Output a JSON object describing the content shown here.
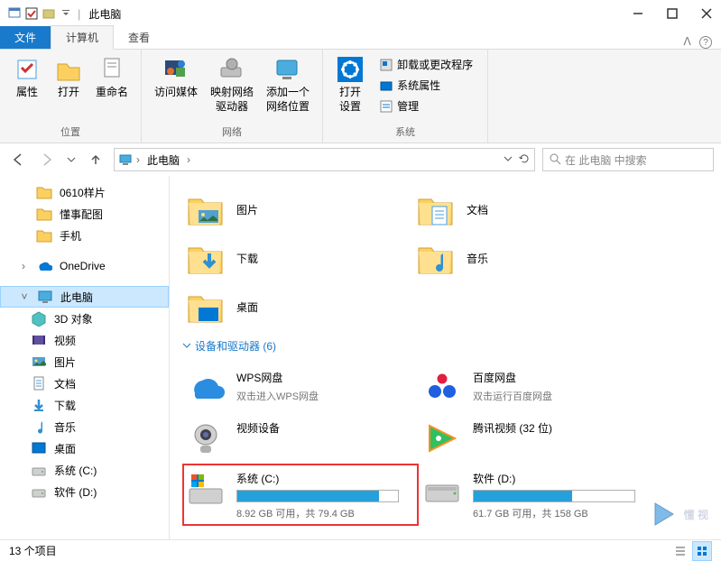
{
  "window": {
    "title": "此电脑"
  },
  "tabs": {
    "file": "文件",
    "computer": "计算机",
    "view": "查看"
  },
  "ribbon": {
    "g_loc": {
      "props": "属性",
      "open": "打开",
      "rename": "重命名",
      "label": "位置"
    },
    "g_net": {
      "media": "访问媒体",
      "net_drive": "映射网络\n驱动器",
      "add_loc": "添加一个\n网络位置",
      "label": "网络"
    },
    "g_sys": {
      "open_settings": "打开\n设置",
      "uninstall": "卸载或更改程序",
      "props": "系统属性",
      "manage": "管理",
      "label": "系统"
    }
  },
  "breadcrumbs": {
    "root": "此电脑"
  },
  "search": {
    "placeholder": "在 此电脑 中搜索"
  },
  "sidebar": {
    "items": [
      {
        "label": "0610样片",
        "type": "folder"
      },
      {
        "label": "懂事配图",
        "type": "folder"
      },
      {
        "label": "手机",
        "type": "folder"
      },
      {
        "label": "OneDrive",
        "type": "onedrive"
      },
      {
        "label": "此电脑",
        "type": "pc",
        "sel": true
      },
      {
        "label": "3D 对象",
        "type": "3d",
        "indent": true
      },
      {
        "label": "视频",
        "type": "video",
        "indent": true
      },
      {
        "label": "图片",
        "type": "pic",
        "indent": true
      },
      {
        "label": "文档",
        "type": "doc",
        "indent": true
      },
      {
        "label": "下载",
        "type": "dl",
        "indent": true
      },
      {
        "label": "音乐",
        "type": "music",
        "indent": true
      },
      {
        "label": "桌面",
        "type": "desk",
        "indent": true
      },
      {
        "label": "系统 (C:)",
        "type": "drive",
        "indent": true
      },
      {
        "label": "软件 (D:)",
        "type": "drive",
        "indent": true
      }
    ]
  },
  "content": {
    "folders": [
      {
        "label": "图片",
        "type": "pic"
      },
      {
        "label": "文档",
        "type": "doc"
      },
      {
        "label": "下载",
        "type": "dl"
      },
      {
        "label": "音乐",
        "type": "music"
      },
      {
        "label": "桌面",
        "type": "desk"
      }
    ],
    "section_head": "设备和驱动器 (6)",
    "drives": [
      {
        "name": "WPS网盘",
        "sub": "双击进入WPS网盘",
        "type": "wps"
      },
      {
        "name": "百度网盘",
        "sub": "双击运行百度网盘",
        "type": "baidu"
      },
      {
        "name": "视频设备",
        "sub": "",
        "type": "cam"
      },
      {
        "name": "腾讯视频 (32 位)",
        "sub": "",
        "type": "tencent"
      },
      {
        "name": "系统 (C:)",
        "info": "8.92 GB 可用，共 79.4 GB",
        "type": "sysdrive",
        "fill": 88,
        "boxed": true
      },
      {
        "name": "软件 (D:)",
        "info": "61.7 GB 可用，共 158 GB",
        "type": "drive",
        "fill": 61
      }
    ]
  },
  "status": {
    "count": "13 个项目"
  },
  "watermark": "懂 视"
}
